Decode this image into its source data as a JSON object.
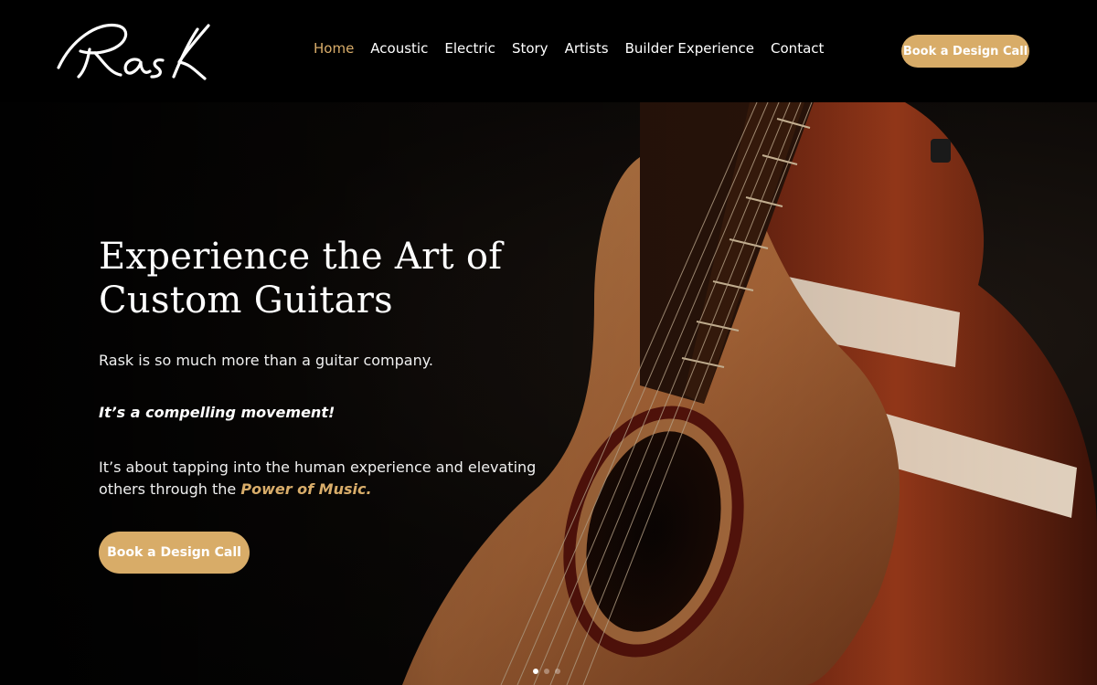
{
  "brand": {
    "logo_text": "Rask"
  },
  "nav": {
    "items": [
      {
        "label": "Home",
        "active": true
      },
      {
        "label": "Acoustic",
        "active": false
      },
      {
        "label": "Electric",
        "active": false
      },
      {
        "label": "Story",
        "active": false
      },
      {
        "label": "Artists",
        "active": false
      },
      {
        "label": "Builder Experience",
        "active": false
      },
      {
        "label": "Contact",
        "active": false
      }
    ],
    "cta_label": "Book a Design Call"
  },
  "hero": {
    "title": "Experience the Art of Custom Guitars",
    "intro": "Rask is so much more than a guitar company.",
    "tagline": "It’s a compelling movement!",
    "body_prefix": "It’s about tapping into the human experience and elevating others through the ",
    "body_highlight": "Power of Music.",
    "cta_label": "Book a Design Call",
    "slides": {
      "count": 3,
      "active_index": 1
    }
  },
  "colors": {
    "accent": "#d8ac68",
    "background": "#000000",
    "text": "#ffffff"
  }
}
